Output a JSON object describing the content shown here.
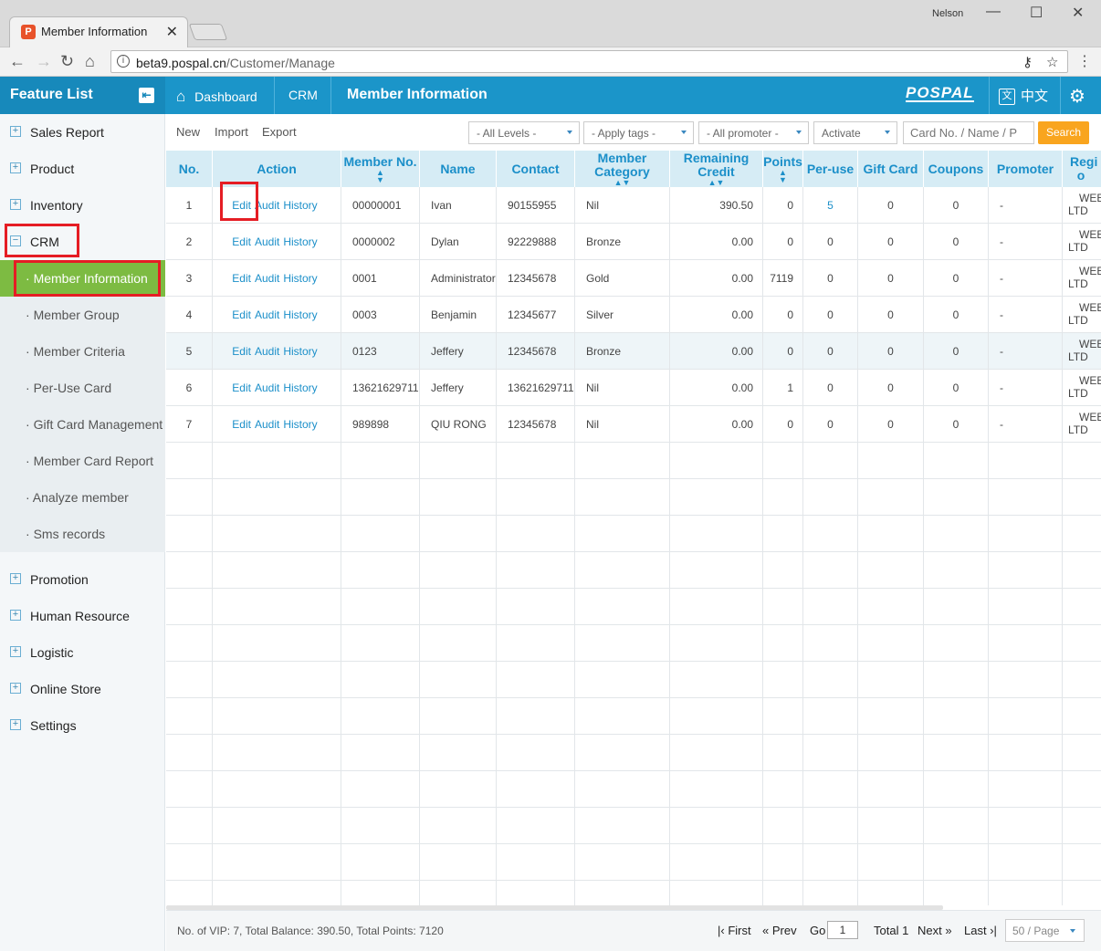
{
  "browser": {
    "tab_title": "Member Information",
    "user": "Nelson",
    "url_host": "beta9.pospal.cn",
    "url_path": "/Customer/Manage"
  },
  "header": {
    "feature_list": "Feature List",
    "crumbs": [
      "Dashboard",
      "CRM"
    ],
    "current": "Member Information",
    "logo": "POSPAL",
    "lang": "中文",
    "lang_icon": "文"
  },
  "sidebar": {
    "top_items": [
      "Sales Report",
      "Product",
      "Inventory",
      "CRM"
    ],
    "sub_items": [
      "Member Information",
      "Member Group",
      "Member Criteria",
      "Per-Use Card",
      "Gift Card Management",
      "Member Card Report",
      "Analyze member",
      "Sms records"
    ],
    "bottom_items": [
      "Promotion",
      "Human Resource",
      "Logistic",
      "Online Store",
      "Settings"
    ]
  },
  "toolbar": {
    "new": "New",
    "import": "Import",
    "export": "Export",
    "levels": "- All Levels -",
    "tags": "- Apply tags -",
    "promoter": "- All promoter -",
    "activate": "Activate",
    "search_placeholder": "Card No. / Name / P",
    "search": "Search"
  },
  "table": {
    "headers": {
      "no": "No.",
      "action": "Action",
      "member_no": "Member No.",
      "name": "Name",
      "contact": "Contact",
      "category": "Member Category",
      "credit": "Remaining Credit",
      "points": "Points",
      "peruse": "Per-use",
      "giftcard": "Gift Card",
      "coupons": "Coupons",
      "promoter": "Promoter",
      "region": "Regi o"
    },
    "actions": [
      "Edit",
      "Audit",
      "History"
    ],
    "rows": [
      {
        "no": "1",
        "member_no": "00000001",
        "name": "Ivan",
        "contact": "90155955",
        "category": "Nil",
        "credit": "390.50",
        "points": "0",
        "peruse": "5",
        "gift": "0",
        "coupons": "0",
        "promoter": "-",
        "region1": "WEE",
        "region2": "LTD"
      },
      {
        "no": "2",
        "member_no": "0000002",
        "name": "Dylan",
        "contact": "92229888",
        "category": "Bronze",
        "credit": "0.00",
        "points": "0",
        "peruse": "0",
        "gift": "0",
        "coupons": "0",
        "promoter": "-",
        "region1": "WEE",
        "region2": "LTD"
      },
      {
        "no": "3",
        "member_no": "0001",
        "name": "Administrator",
        "contact": "12345678",
        "category": "Gold",
        "credit": "0.00",
        "points": "7119",
        "peruse": "0",
        "gift": "0",
        "coupons": "0",
        "promoter": "-",
        "region1": "WEE",
        "region2": "LTD"
      },
      {
        "no": "4",
        "member_no": "0003",
        "name": "Benjamin",
        "contact": "12345677",
        "category": "Silver",
        "credit": "0.00",
        "points": "0",
        "peruse": "0",
        "gift": "0",
        "coupons": "0",
        "promoter": "-",
        "region1": "WEE",
        "region2": "LTD"
      },
      {
        "no": "5",
        "member_no": "0123",
        "name": "Jeffery",
        "contact": "12345678",
        "category": "Bronze",
        "credit": "0.00",
        "points": "0",
        "peruse": "0",
        "gift": "0",
        "coupons": "0",
        "promoter": "-",
        "region1": "WEE",
        "region2": "LTD"
      },
      {
        "no": "6",
        "member_no": "13621629711",
        "name": "Jeffery",
        "contact": "13621629711",
        "category": "Nil",
        "credit": "0.00",
        "points": "1",
        "peruse": "0",
        "gift": "0",
        "coupons": "0",
        "promoter": "-",
        "region1": "WEE",
        "region2": "LTD"
      },
      {
        "no": "7",
        "member_no": "989898",
        "name": "QIU RONG",
        "contact": "12345678",
        "category": "Nil",
        "credit": "0.00",
        "points": "0",
        "peruse": "0",
        "gift": "0",
        "coupons": "0",
        "promoter": "-",
        "region1": "WEE",
        "region2": "LTD"
      }
    ]
  },
  "footer": {
    "summary": "No. of VIP: 7, Total Balance: 390.50, Total Points: 7120",
    "first": "First",
    "prev": "Prev",
    "go": "Go",
    "page": "1",
    "total": "Total 1",
    "next": "Next",
    "last": "Last",
    "per_page": "50 / Page"
  },
  "colors": {
    "header_blue": "#1b95c9",
    "active_green": "#7dbb42",
    "search_orange": "#f9a51e",
    "highlight_red": "#e51d24"
  }
}
